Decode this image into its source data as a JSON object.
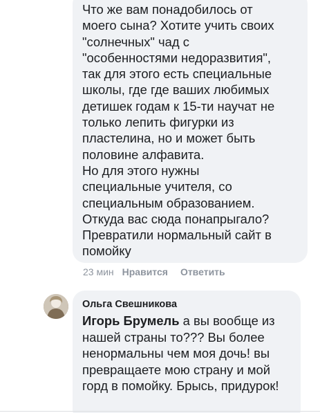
{
  "top_comment": {
    "text": "Что же вам понадобилось от\nмоего сына? Хотите учить своих\n\"солнечных\" чад с\n\"особенностями недоразвития\",\nтак для этого есть специальные\nшколы, где где ваших любимых\nдетишек годам к 15-ти научат не\nтолько лепить фигурки из\nпластелина, но и может быть\nполовине алфавита.\nНо для этого нужны\nспециальные учителя, со\nспециальным образованием.\nОткуда  вас сюда понапрыгало?\nПревратили нормальный сайт в\nпомойку",
    "time": "23 мин",
    "like_label": "Нравится",
    "reply_label": "Ответить"
  },
  "reply_comment": {
    "author": "Ольга Свешникова",
    "mention": "Игорь Брумель",
    "text": " а вы вообще из нашей страны то??? Вы более ненормальны чем моя дочь! вы превращаете мою страну и мой горд в помойку. Брысь, придурок!",
    "avatar_icon": "profile-photo-avatar"
  },
  "colors": {
    "bubble_bg": "#f0f2f5",
    "text": "#1c1e21",
    "meta": "#8d949e"
  }
}
